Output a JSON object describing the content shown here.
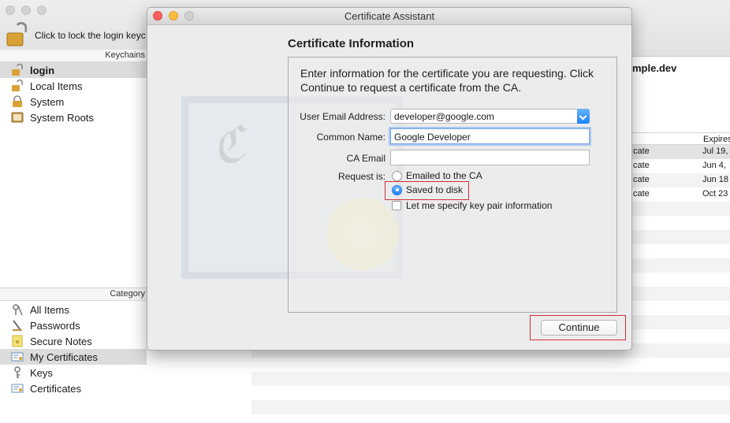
{
  "keychain": {
    "lock_label": "Click to lock the login keyc",
    "keychains_header": "Keychains",
    "keychains": [
      {
        "label": "login",
        "icon": "unlocked-padlock-icon",
        "selected": true
      },
      {
        "label": "Local Items",
        "icon": "unlocked-padlock-icon"
      },
      {
        "label": "System",
        "icon": "padlock-icon"
      },
      {
        "label": "System Roots",
        "icon": "cabinet-icon"
      }
    ],
    "category_header": "Category",
    "categories": [
      {
        "label": "All Items",
        "icon": "all-items-icon"
      },
      {
        "label": "Passwords",
        "icon": "key-pen-icon"
      },
      {
        "label": "Secure Notes",
        "icon": "note-icon"
      },
      {
        "label": "My Certificates",
        "icon": "certificate-icon",
        "selected": true
      },
      {
        "label": "Keys",
        "icon": "key-icon"
      },
      {
        "label": "Certificates",
        "icon": "certificate-icon"
      }
    ],
    "selected_cert_name": "mple.dev",
    "expires_header": "Expires",
    "rows": [
      {
        "kind": "cate",
        "expires": "Jul 19,"
      },
      {
        "kind": "cate",
        "expires": "Jun 4,"
      },
      {
        "kind": "cate",
        "expires": "Jun 18"
      },
      {
        "kind": "cate",
        "expires": "Oct 23"
      }
    ]
  },
  "dialog": {
    "title": "Certificate Assistant",
    "section_title": "Certificate Information",
    "intro": "Enter information for the certificate you are requesting. Click Continue to request a certificate from the CA.",
    "email_label": "User Email Address:",
    "email_value": "developer@google.com",
    "common_name_label": "Common Name:",
    "common_name_value": "Google Developer",
    "ca_email_label": "CA Email",
    "ca_email_value": "",
    "request_label": "Request is:",
    "option_emailed": "Emailed to the CA",
    "option_saved": "Saved to disk",
    "specify_key_pair": "Let me specify key pair information",
    "continue": "Continue",
    "accent_color": "#1a82fb",
    "highlight_color": "#d0303a"
  }
}
